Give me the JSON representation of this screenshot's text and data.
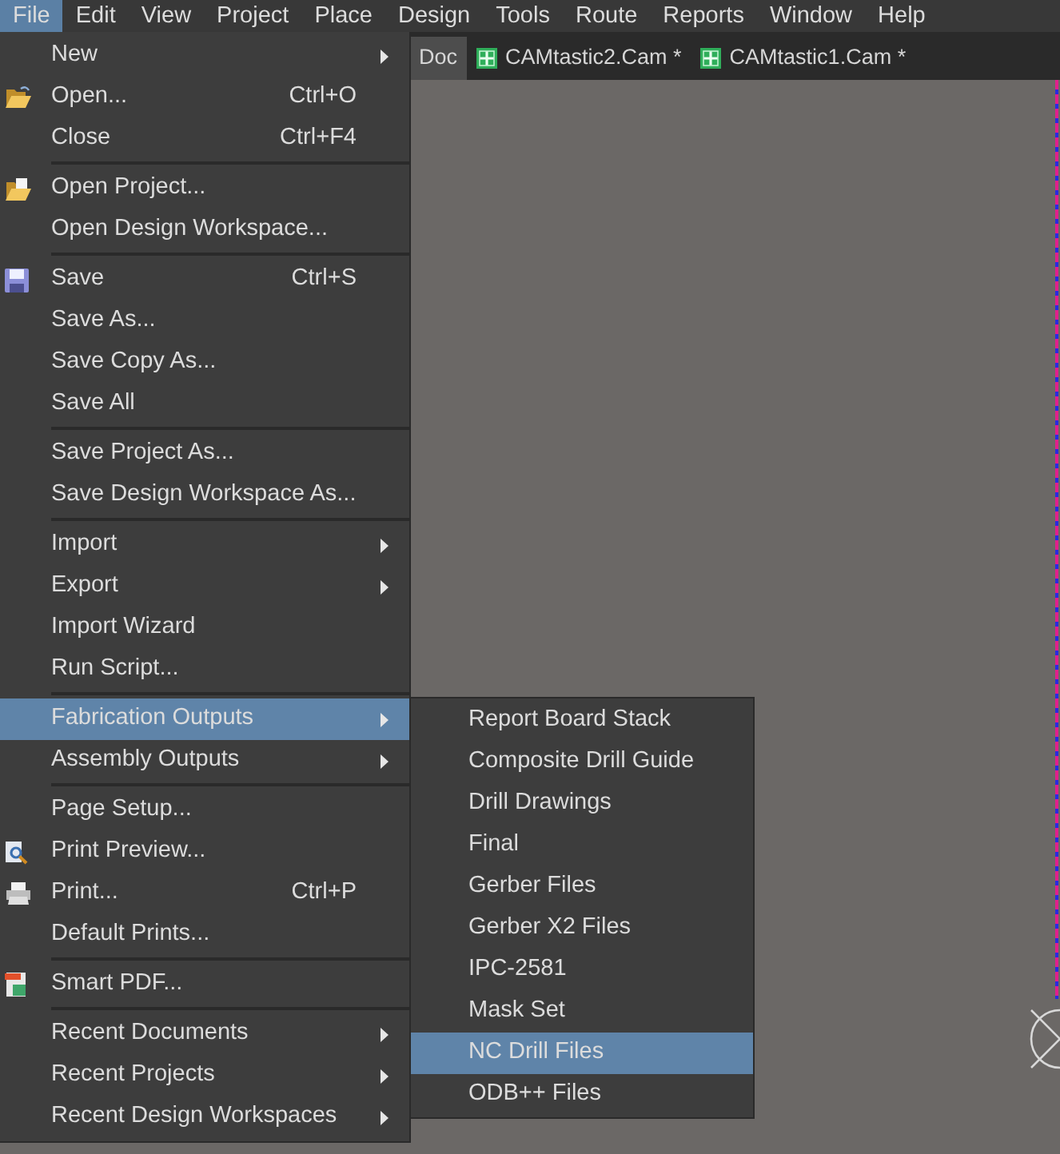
{
  "menu_bar": [
    {
      "label": "File",
      "selected": true
    },
    {
      "label": "Edit",
      "selected": false
    },
    {
      "label": "View",
      "selected": false
    },
    {
      "label": "Project",
      "selected": false
    },
    {
      "label": "Place",
      "selected": false
    },
    {
      "label": "Design",
      "selected": false
    },
    {
      "label": "Tools",
      "selected": false
    },
    {
      "label": "Route",
      "selected": false
    },
    {
      "label": "Reports",
      "selected": false
    },
    {
      "label": "Window",
      "selected": false
    },
    {
      "label": "Help",
      "selected": false
    }
  ],
  "document_tabs": [
    {
      "label": "Doc",
      "kind": "doc",
      "selected": true
    },
    {
      "label": "CAMtastic2.Cam *",
      "kind": "cam",
      "selected": false
    },
    {
      "label": "CAMtastic1.Cam *",
      "kind": "cam",
      "selected": false
    }
  ],
  "file_menu": {
    "groups": [
      [
        {
          "label": "New",
          "submenu": true,
          "selected": false
        },
        {
          "label": "Open...",
          "shortcut": "Ctrl+O",
          "submenu": false,
          "selected": false
        },
        {
          "label": "Close",
          "shortcut": "Ctrl+F4",
          "submenu": false,
          "selected": false
        }
      ],
      [
        {
          "label": "Open Project...",
          "submenu": false,
          "selected": false
        },
        {
          "label": "Open Design Workspace...",
          "submenu": false,
          "selected": false
        }
      ],
      [
        {
          "label": "Save",
          "shortcut": "Ctrl+S",
          "submenu": false,
          "selected": false
        },
        {
          "label": "Save As...",
          "submenu": false,
          "selected": false
        },
        {
          "label": "Save Copy As...",
          "submenu": false,
          "selected": false
        },
        {
          "label": "Save All",
          "submenu": false,
          "selected": false
        }
      ],
      [
        {
          "label": "Save Project As...",
          "submenu": false,
          "selected": false
        },
        {
          "label": "Save Design Workspace As...",
          "submenu": false,
          "selected": false
        }
      ],
      [
        {
          "label": "Import",
          "submenu": true,
          "selected": false
        },
        {
          "label": "Export",
          "submenu": true,
          "selected": false
        },
        {
          "label": "Import Wizard",
          "submenu": false,
          "selected": false
        },
        {
          "label": "Run Script...",
          "submenu": false,
          "selected": false
        }
      ],
      [
        {
          "label": "Fabrication Outputs",
          "submenu": true,
          "selected": true
        },
        {
          "label": "Assembly Outputs",
          "submenu": true,
          "selected": false
        }
      ],
      [
        {
          "label": "Page Setup...",
          "submenu": false,
          "selected": false
        },
        {
          "label": "Print Preview...",
          "submenu": false,
          "selected": false
        },
        {
          "label": "Print...",
          "shortcut": "Ctrl+P",
          "submenu": false,
          "selected": false
        },
        {
          "label": "Default Prints...",
          "submenu": false,
          "selected": false
        }
      ],
      [
        {
          "label": "Smart PDF...",
          "submenu": false,
          "selected": false
        }
      ],
      [
        {
          "label": "Recent Documents",
          "submenu": true,
          "selected": false
        },
        {
          "label": "Recent Projects",
          "submenu": true,
          "selected": false
        },
        {
          "label": "Recent Design Workspaces",
          "submenu": true,
          "selected": false
        }
      ]
    ]
  },
  "fabrication_outputs_submenu": {
    "items": [
      {
        "label": "Report Board Stack",
        "selected": false
      },
      {
        "label": "Composite Drill Guide",
        "selected": false
      },
      {
        "label": "Drill Drawings",
        "selected": false
      },
      {
        "label": "Final",
        "selected": false
      },
      {
        "label": "Gerber Files",
        "selected": false
      },
      {
        "label": "Gerber X2 Files",
        "selected": false
      },
      {
        "label": "IPC-2581",
        "selected": false
      },
      {
        "label": "Mask Set",
        "selected": false
      },
      {
        "label": "NC Drill Files",
        "selected": true
      },
      {
        "label": "ODB++ Files",
        "selected": false
      }
    ]
  }
}
